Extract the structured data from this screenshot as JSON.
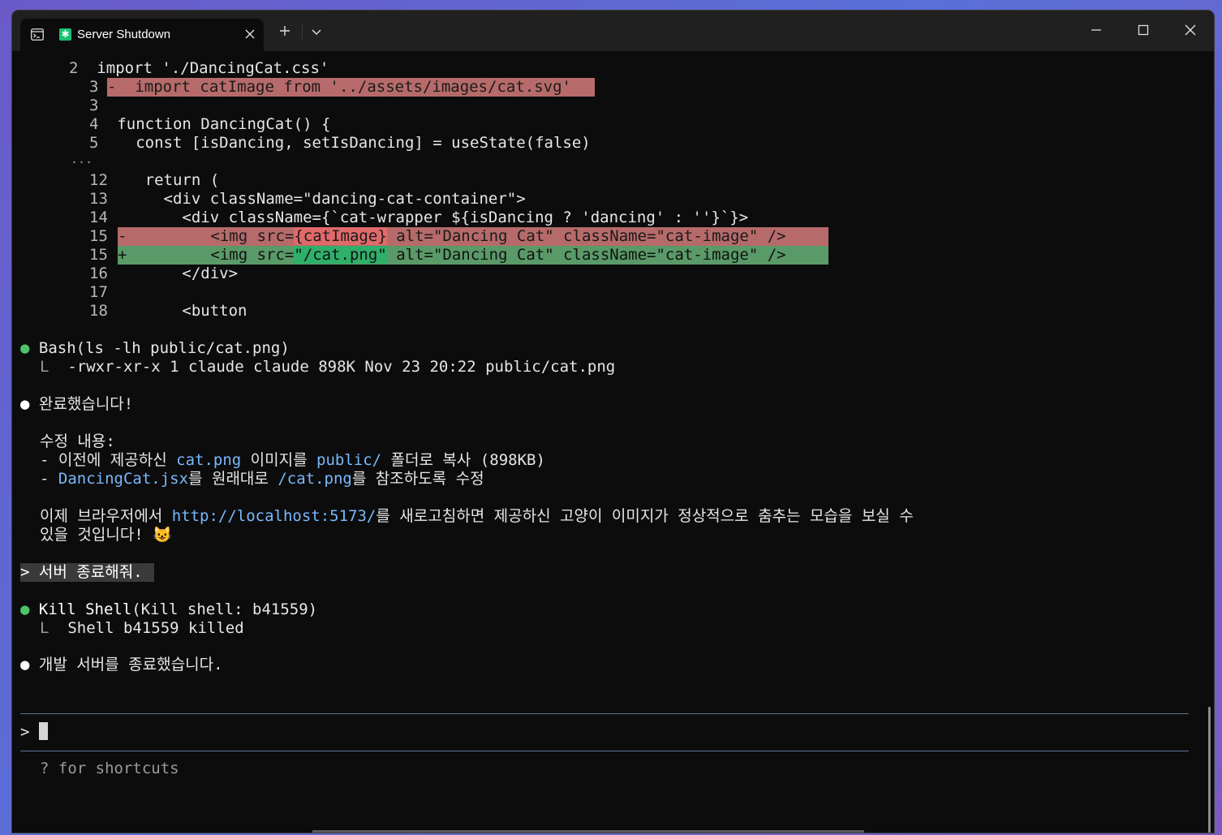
{
  "window": {
    "tab_title": "Server Shutdown",
    "tab_icon": "app-icon",
    "new_tab_label": "+",
    "dropdown_label": "⌄",
    "minimize_label": "—",
    "maximize_label": "☐",
    "close_label": "✕"
  },
  "diff": {
    "lines": [
      {
        "num": "2",
        "marker": " ",
        "code": "import './DancingCat.css'"
      },
      {
        "num": "3",
        "marker": "-",
        "code": "import catImage from '../assets/images/cat.svg'"
      },
      {
        "num": "3",
        "marker": " ",
        "code": ""
      },
      {
        "num": "4",
        "marker": " ",
        "code": "function DancingCat() {"
      },
      {
        "num": "5",
        "marker": " ",
        "code": "  const [isDancing, setIsDancing] = useState(false)"
      },
      {
        "num": "...",
        "marker": "",
        "code": ""
      },
      {
        "num": "12",
        "marker": " ",
        "code": "   return ("
      },
      {
        "num": "13",
        "marker": " ",
        "code": "     <div className=\"dancing-cat-container\">"
      },
      {
        "num": "14",
        "marker": " ",
        "code": "       <div className={`cat-wrapper ${isDancing ? 'dancing' : ''}`}>"
      },
      {
        "num": "15",
        "marker": "-",
        "code_pre": "         <img src=",
        "code_hl": "{catImage}",
        "code_post": " alt=\"Dancing Cat\" className=\"cat-image\" />"
      },
      {
        "num": "15",
        "marker": "+",
        "code_pre": "         <img src=",
        "code_hl": "\"/cat.png\"",
        "code_post": " alt=\"Dancing Cat\" className=\"cat-image\" />"
      },
      {
        "num": "16",
        "marker": " ",
        "code": "       </div>"
      },
      {
        "num": "17",
        "marker": " ",
        "code": ""
      },
      {
        "num": "18",
        "marker": " ",
        "code": "       <button"
      }
    ]
  },
  "bash": {
    "bullet": "●",
    "command": "Bash(ls -lh public/cat.png)",
    "branch": "L",
    "output": "-rwxr-xr-x 1 claude claude 898K Nov 23 20:22 public/cat.png"
  },
  "done_msg": {
    "bullet": "●",
    "text": "완료했습니다!",
    "heading": "수정 내용:",
    "item1_pre": "- 이전에 제공하신 ",
    "item1_code": "cat.png",
    "item1_mid": " 이미지를 ",
    "item1_code2": "public/",
    "item1_post": " 폴더로 복사 (898KB)",
    "item2_pre": "- ",
    "item2_code": "DancingCat.jsx",
    "item2_mid": "를 원래대로 ",
    "item2_code2": "/cat.png",
    "item2_post": "를 참조하도록 수정",
    "para_pre": "이제 브라우저에서 ",
    "para_link": "http://localhost:5173/",
    "para_post": "를 새로고침하면 제공하신 고양이 이미지가 정상적으로 춤추는 모습을 보실 수",
    "para_line2": "있을 것입니다! 😺"
  },
  "user_prompt": "> 서버 종료해줘.",
  "kill": {
    "bullet": "●",
    "command_name": "Kill Shell",
    "command_args": "(Kill shell: b41559)",
    "branch": "L",
    "output": "Shell b41559 killed"
  },
  "final_msg": {
    "bullet": "●",
    "text": "개발 서버를 종료했습니다."
  },
  "input": {
    "prompt": ">",
    "hint": "? for shortcuts"
  }
}
